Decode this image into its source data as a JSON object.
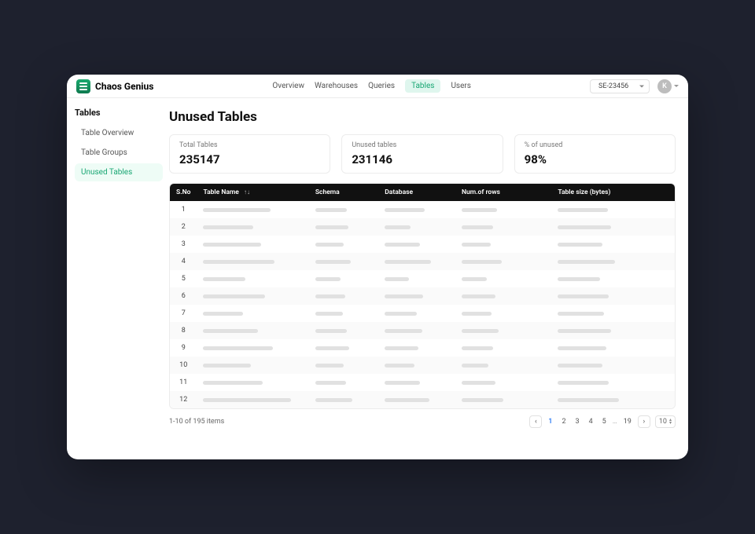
{
  "brand": "Chaos Genius",
  "topnav": {
    "overview": "Overview",
    "warehouses": "Warehouses",
    "queries": "Queries",
    "tables": "Tables",
    "users": "Users",
    "active": "tables"
  },
  "account_id": "SE-23456",
  "avatar_initial": "K",
  "sidebar": {
    "heading": "Tables",
    "items": [
      {
        "label": "Table Overview"
      },
      {
        "label": "Table Groups"
      },
      {
        "label": "Unused Tables",
        "active": true
      }
    ]
  },
  "page_title": "Unused Tables",
  "stats": [
    {
      "label": "Total Tables",
      "value": "235147"
    },
    {
      "label": "Unused tables",
      "value": "231146"
    },
    {
      "label": "% of unused",
      "value": "98%"
    }
  ],
  "columns": {
    "sno": "S.No",
    "name": "Table Name",
    "schema": "Schema",
    "database": "Database",
    "rows": "Num.of rows",
    "size": "Table size (bytes)"
  },
  "row_count": 12,
  "pagination": {
    "summary": "1-10 of 195 items",
    "pages": [
      "1",
      "2",
      "3",
      "4",
      "5"
    ],
    "last_page": "19",
    "active_page": "1",
    "page_size": "10"
  },
  "skeleton_widths": {
    "name": [
      "68%",
      "50%",
      "58%",
      "72%",
      "42%",
      "62%",
      "40%",
      "55%",
      "70%",
      "48%",
      "60%",
      "88%"
    ],
    "schema": [
      "55%",
      "58%",
      "50%",
      "62%",
      "45%",
      "52%",
      "48%",
      "56%",
      "60%",
      "50%",
      "54%",
      "65%"
    ],
    "database": [
      "62%",
      "40%",
      "55%",
      "72%",
      "38%",
      "60%",
      "50%",
      "58%",
      "52%",
      "46%",
      "55%",
      "70%"
    ],
    "rows": [
      "42%",
      "38%",
      "35%",
      "48%",
      "30%",
      "40%",
      "36%",
      "44%",
      "38%",
      "32%",
      "40%",
      "50%"
    ],
    "size": [
      "45%",
      "48%",
      "40%",
      "52%",
      "38%",
      "46%",
      "42%",
      "48%",
      "44%",
      "40%",
      "46%",
      "55%"
    ]
  }
}
